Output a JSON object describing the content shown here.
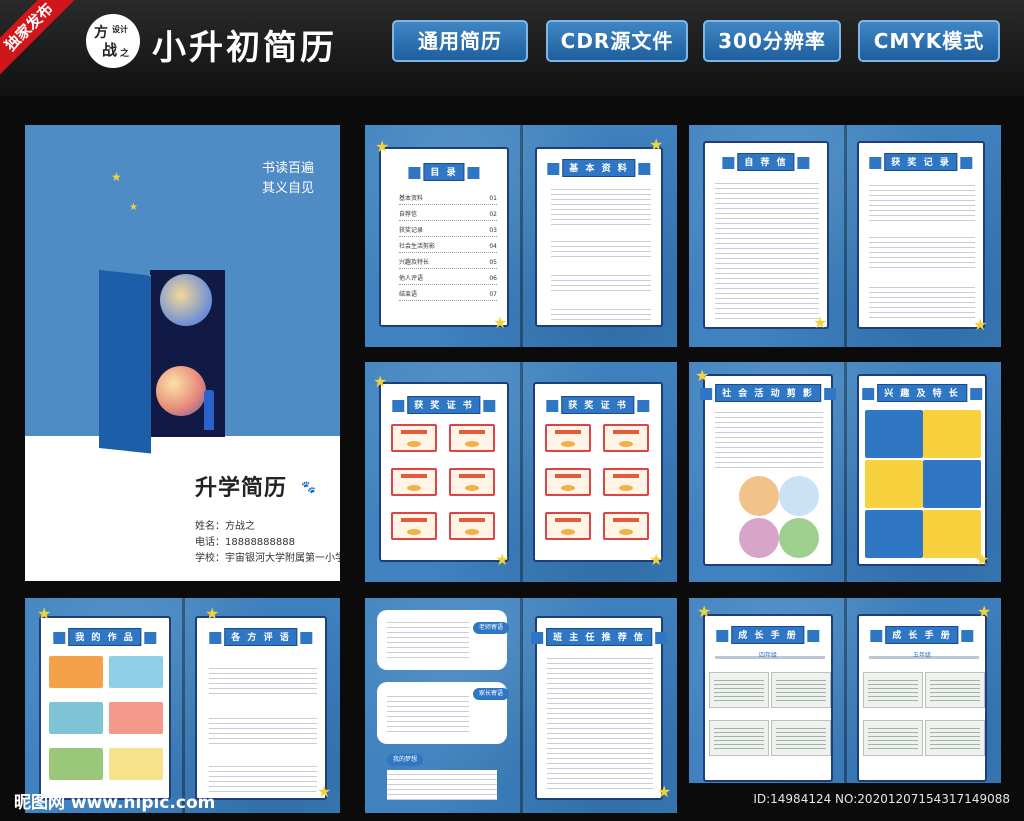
{
  "header": {
    "ribbon": "独家发布",
    "logo_chars": [
      "方",
      "设计",
      "战",
      "之"
    ],
    "title": "小升初简历",
    "features": [
      "通用简历",
      "CDR源文件",
      "300分辨率",
      "CMYK模式"
    ]
  },
  "cover": {
    "motto": [
      "书读百遍",
      "其义自见"
    ],
    "title": "升学简历",
    "paw": "🐾",
    "name_line": "姓名：方战之",
    "phone_line": "电话：18888888888",
    "school_line": "学校：宇宙银河大学附属第一小学"
  },
  "toc": {
    "title": "目 录",
    "items": [
      {
        "label": "基本资料",
        "num": "01"
      },
      {
        "label": "自荐信",
        "num": "02"
      },
      {
        "label": "获奖记录",
        "num": "03"
      },
      {
        "label": "社会生活剪影",
        "num": "04"
      },
      {
        "label": "兴趣及特长",
        "num": "05"
      },
      {
        "label": "他人评语",
        "num": "06"
      },
      {
        "label": "结束语",
        "num": "07"
      }
    ]
  },
  "pages": {
    "basic_info": "基 本 资 料",
    "self_intro": "自 荐 信",
    "awards_record": "获 奖 记 录",
    "certificates_a": "获 奖 证 书",
    "certificates_b": "获 奖 证 书",
    "social_photos": "社 会 活 动 剪 影",
    "hobbies": "兴 趣 及 特 长",
    "works": "我 的 作 品",
    "reviews": "各 方 评 语",
    "teacher_letter": "班 主 任 推 荐 信",
    "growth_a": "成 长 手 册",
    "growth_b": "成 长 手 册"
  },
  "labels": {
    "teacher_review": "老师寄语",
    "parent_review": "家长寄语",
    "my_dream": "我的梦想",
    "grade4": "四年级",
    "grade5": "五年级"
  },
  "watermark": {
    "left": "昵图网 www.nipic.com",
    "right": "ID:14984124 NO:20201207154317149088"
  },
  "colors": {
    "brand_blue": "#3f82bf",
    "title_blue": "#2f76c4",
    "ribbon_red": "#d0161b",
    "star_yellow": "#f3d23a"
  }
}
